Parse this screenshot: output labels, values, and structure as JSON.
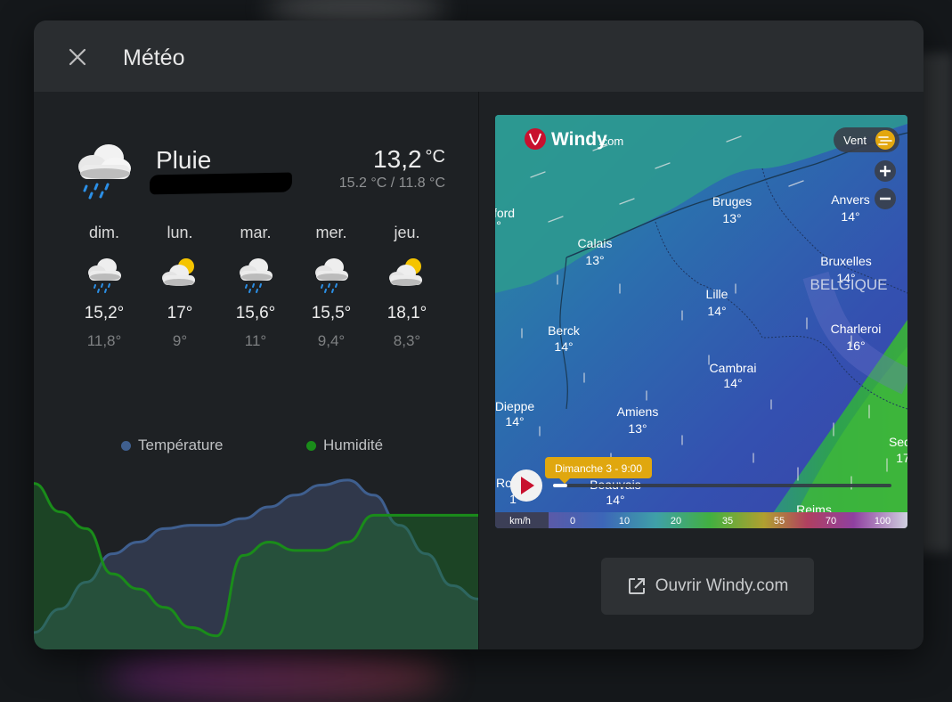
{
  "dialog": {
    "title": "Météo"
  },
  "current": {
    "condition": "Pluie",
    "temperature": "13,2",
    "unit": "°C",
    "range": "15.2 °C / 11.8 °C",
    "icon": "cloud-rain-icon"
  },
  "forecast": [
    {
      "day": "dim.",
      "high": "15,2°",
      "low": "11,8°",
      "icon": "cloud-rain-icon"
    },
    {
      "day": "lun.",
      "high": "17°",
      "low": "9°",
      "icon": "cloud-sun-icon"
    },
    {
      "day": "mar.",
      "high": "15,6°",
      "low": "11°",
      "icon": "cloud-rain-icon"
    },
    {
      "day": "mer.",
      "high": "15,5°",
      "low": "9,4°",
      "icon": "cloud-rain-icon"
    },
    {
      "day": "jeu.",
      "high": "18,1°",
      "low": "8,3°",
      "icon": "cloud-sun-icon"
    }
  ],
  "legend": {
    "temperature": "Température",
    "humidity": "Humidité",
    "temperature_color": "#3f5f8f",
    "humidity_color": "#1a8c1a"
  },
  "map": {
    "brand": "Windy",
    "brand_suffix": ".com",
    "layer": "Vent",
    "time": "Dimanche 3 - 9:00",
    "country": "BELGIQUE",
    "scale_unit": "km/h",
    "scale": [
      "0",
      "10",
      "20",
      "35",
      "55",
      "70",
      "100"
    ],
    "cities": [
      {
        "name": "Bruges",
        "temp": "13°"
      },
      {
        "name": "Anvers",
        "temp": "14°"
      },
      {
        "name": "Calais",
        "temp": "13°"
      },
      {
        "name": "Bruxelles",
        "temp": "14°"
      },
      {
        "name": "Lille",
        "temp": "14°"
      },
      {
        "name": "Berck",
        "temp": "14°"
      },
      {
        "name": "Charleroi",
        "temp": "16°"
      },
      {
        "name": "Cambrai",
        "temp": "14°"
      },
      {
        "name": "Dieppe",
        "temp": "14°"
      },
      {
        "name": "Amiens",
        "temp": "13°"
      },
      {
        "name": "Beauvais",
        "temp": "14°"
      },
      {
        "name": "ford",
        "temp": "°"
      },
      {
        "name": "Ro",
        "temp": "1"
      },
      {
        "name": "Sec",
        "temp": "17"
      },
      {
        "name": "Reims",
        "temp": ""
      }
    ]
  },
  "open_button": {
    "label": "Ouvrir Windy.com"
  },
  "chart_data": {
    "type": "area",
    "series": [
      {
        "name": "Température",
        "values": [
          0.08,
          0.22,
          0.38,
          0.55,
          0.62,
          0.7,
          0.72,
          0.72,
          0.76,
          0.83,
          0.9,
          0.96,
          0.99,
          0.9,
          0.72,
          0.55,
          0.36,
          0.28
        ]
      },
      {
        "name": "Humidité",
        "values": [
          0.97,
          0.8,
          0.7,
          0.43,
          0.34,
          0.23,
          0.11,
          0.06,
          0.54,
          0.62,
          0.57,
          0.57,
          0.62,
          0.78,
          0.78,
          0.78,
          0.78,
          0.78
        ]
      }
    ],
    "ylim": [
      0,
      1
    ]
  }
}
